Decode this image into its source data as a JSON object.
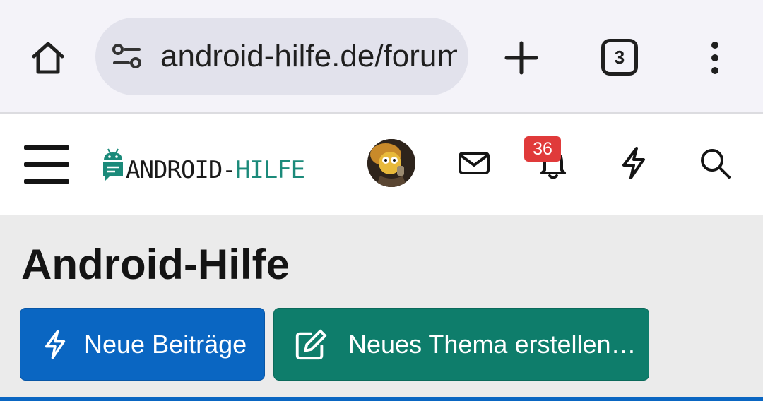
{
  "browser": {
    "url": "android-hilfe.de/forum",
    "tab_count": "3",
    "icons": [
      "home-icon",
      "site-info-icon",
      "plus-icon",
      "tab-switcher-icon",
      "more-vert-icon"
    ]
  },
  "site": {
    "logo": {
      "part1": "ANDROID-",
      "part2": "HILFE"
    },
    "notifications_count": "36",
    "icons": [
      "hamburger-icon",
      "avatar",
      "mail-icon",
      "bell-icon",
      "bolt-icon",
      "search-icon"
    ],
    "colors": {
      "logo_accent": "#1b8a7a",
      "badge": "#e03a3a"
    }
  },
  "page": {
    "title": "Android-Hilfe",
    "buttons": {
      "new_posts": "Neue Beiträge",
      "new_thread": "Neues Thema erstellen…"
    },
    "colors": {
      "primary": "#0a66c2",
      "secondary": "#0e7d6b",
      "background": "#ebebeb"
    }
  }
}
